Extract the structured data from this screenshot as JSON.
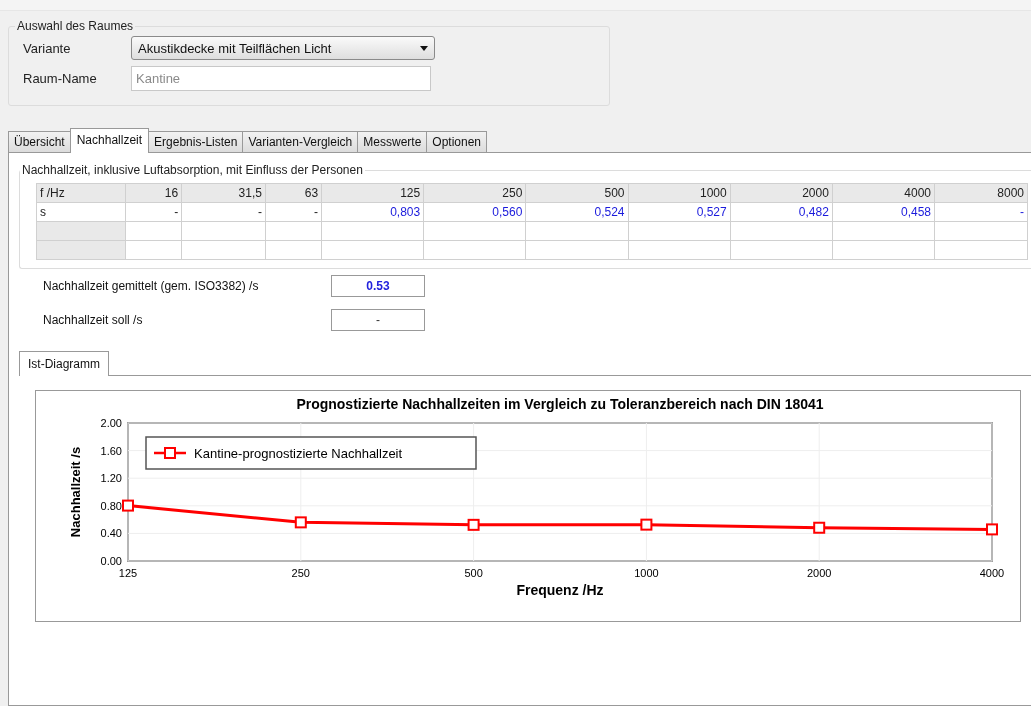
{
  "room_group": {
    "title": "Auswahl des Raumes",
    "variant_label": "Variante",
    "variant_value": "Akustikdecke mit Teilflächen Licht",
    "name_label": "Raum-Name",
    "name_placeholder": "Kantine"
  },
  "tabs": [
    {
      "label": "Übersicht",
      "selected": false
    },
    {
      "label": "Nachhallzeit",
      "selected": true
    },
    {
      "label": "Ergebnis-Listen",
      "selected": false
    },
    {
      "label": "Varianten-Vergleich",
      "selected": false
    },
    {
      "label": "Messwerte",
      "selected": false
    },
    {
      "label": "Optionen",
      "selected": false
    }
  ],
  "reverb_group": {
    "title": "Nachhallzeit, inklusive Luftabsorption, mit Einfluss der Personen",
    "table": {
      "header": {
        "label": "f /Hz",
        "cells": [
          "16",
          "31,5",
          "63",
          "125",
          "250",
          "500",
          "1000",
          "2000",
          "4000",
          "8000"
        ]
      },
      "rows": [
        {
          "label": "s",
          "cells": [
            {
              "text": "-",
              "computed": false
            },
            {
              "text": "-",
              "computed": false
            },
            {
              "text": "-",
              "computed": false
            },
            {
              "text": "0,803",
              "computed": true
            },
            {
              "text": "0,560",
              "computed": true
            },
            {
              "text": "0,524",
              "computed": true
            },
            {
              "text": "0,527",
              "computed": true
            },
            {
              "text": "0,482",
              "computed": true
            },
            {
              "text": "0,458",
              "computed": true
            },
            {
              "text": "-",
              "computed": true
            }
          ]
        }
      ]
    }
  },
  "averages": [
    {
      "label": "Nachhallzeit gemittelt  (gem. ISO3382) /s",
      "value": "0.53",
      "computed": true
    },
    {
      "label": "Nachhallzeit soll /s",
      "value": "-",
      "computed": false
    }
  ],
  "sub_tabs": [
    {
      "label": "Ist-Diagramm",
      "selected": true
    }
  ],
  "chart_data": {
    "type": "line",
    "title": "Prognostizierte Nachhallzeiten  im  Vergleich  zu  Toleranzbereich  nach  DIN  18041",
    "xlabel": "Frequenz /Hz",
    "ylabel": "Nachhallzeit /s",
    "categories": [
      "125",
      "250",
      "500",
      "1000",
      "2000",
      "4000"
    ],
    "grid": true,
    "series": [
      {
        "name": "Kantine-prognostizierte Nachhallzeit",
        "color": "#ff0000",
        "marker": "square",
        "values": [
          0.803,
          0.56,
          0.524,
          0.527,
          0.482,
          0.458
        ]
      }
    ],
    "ylim": [
      0,
      2
    ],
    "yticks": [
      {
        "value": 0,
        "label": "0.00"
      },
      {
        "value": 0.4,
        "label": "0.40"
      },
      {
        "value": 0.8,
        "label": "0.80"
      },
      {
        "value": 1.2,
        "label": "1.20"
      },
      {
        "value": 1.6,
        "label": "1.60"
      },
      {
        "value": 2,
        "label": "2.00"
      }
    ]
  }
}
